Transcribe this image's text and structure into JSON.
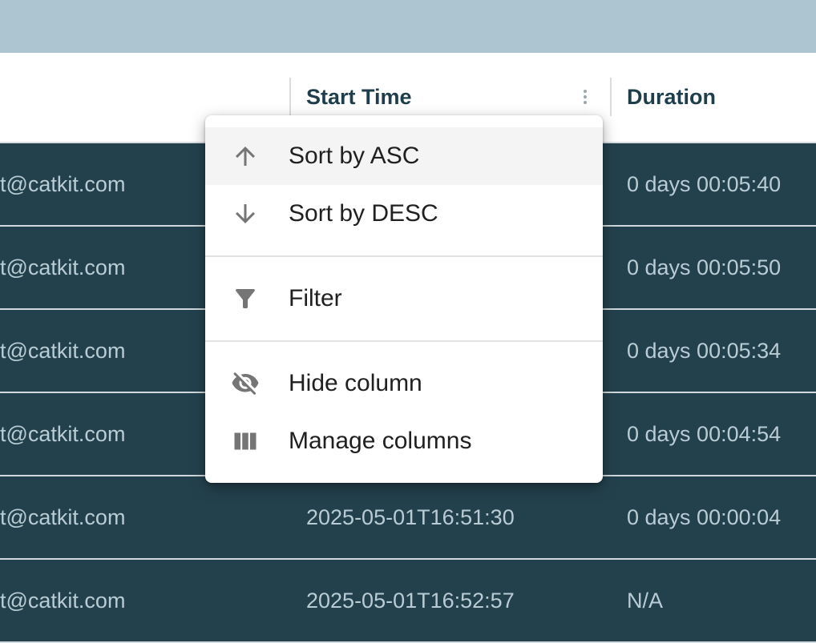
{
  "header": {
    "columns": [
      {
        "label": "Start Time"
      },
      {
        "label": "Duration"
      }
    ]
  },
  "rows": [
    {
      "email": "t@catkit.com",
      "start_time": "",
      "duration": "0 days 00:05:40"
    },
    {
      "email": "t@catkit.com",
      "start_time": "",
      "duration": "0 days 00:05:50"
    },
    {
      "email": "t@catkit.com",
      "start_time": "",
      "duration": "0 days 00:05:34"
    },
    {
      "email": "t@catkit.com",
      "start_time": "",
      "duration": "0 days 00:04:54"
    },
    {
      "email": "t@catkit.com",
      "start_time": "2025-05-01T16:51:30",
      "duration": "0 days 00:00:04"
    },
    {
      "email": "t@catkit.com",
      "start_time": "2025-05-01T16:52:57",
      "duration": "N/A"
    }
  ],
  "column_menu": {
    "items": [
      {
        "label": "Sort by ASC",
        "icon": "arrow-up-icon"
      },
      {
        "label": "Sort by DESC",
        "icon": "arrow-down-icon"
      },
      {
        "label": "Filter",
        "icon": "filter-icon"
      },
      {
        "label": "Hide column",
        "icon": "eye-off-icon"
      },
      {
        "label": "Manage columns",
        "icon": "columns-icon"
      }
    ]
  },
  "colors": {
    "top_bar": "#adc5d0",
    "row_background": "#23414d",
    "row_text": "#b9ccd4",
    "header_text": "#1f3e4b",
    "menu_hover": "#f4f4f4"
  }
}
